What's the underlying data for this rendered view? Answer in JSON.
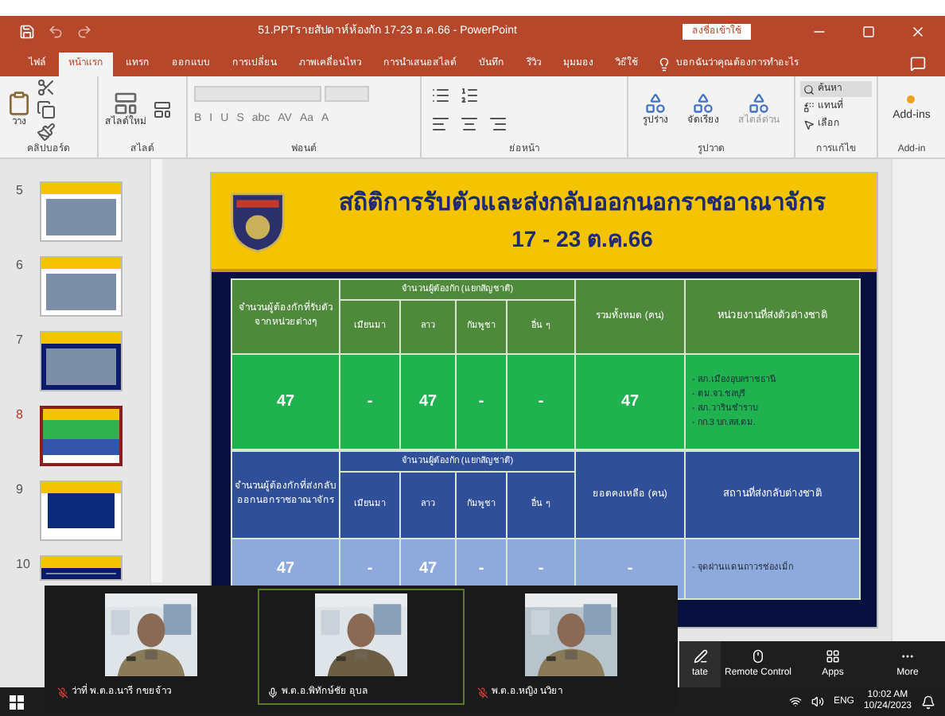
{
  "window": {
    "title": "51.PPTรายสัปดาห์ห้องกัก 17-23 ต.ค.66 - PowerPoint",
    "sign_in": "ลงชื่อเข้าใช้"
  },
  "ribbon_tabs": [
    {
      "label": "ไฟล์",
      "selected": false
    },
    {
      "label": "หน้าแรก",
      "selected": true
    },
    {
      "label": "แทรก",
      "selected": false
    },
    {
      "label": "ออกแบบ",
      "selected": false
    },
    {
      "label": "การเปลี่ยน",
      "selected": false
    },
    {
      "label": "ภาพเคลื่อนไหว",
      "selected": false
    },
    {
      "label": "การนำเสนอสไลด์",
      "selected": false
    },
    {
      "label": "บันทึก",
      "selected": false
    },
    {
      "label": "รีวิว",
      "selected": false
    },
    {
      "label": "มุมมอง",
      "selected": false
    },
    {
      "label": "วิธีใช้",
      "selected": false
    }
  ],
  "tell_me": "บอกฉันว่าคุณต้องการทำอะไร",
  "ribbon": {
    "clipboard": {
      "label": "คลิปบอร์ด",
      "paste": "วาง"
    },
    "slides": {
      "label": "สไลด์",
      "new_slide": "สไลด์ใหม่"
    },
    "font": {
      "label": "ฟอนต์",
      "buttons": [
        "B",
        "I",
        "U",
        "S",
        "abc",
        "AV",
        "Aa",
        "A"
      ]
    },
    "paragraph": {
      "label": "ย่อหน้า"
    },
    "drawing": {
      "label": "รูปวาด",
      "buttons": [
        "รูปร่าง",
        "จัดเรียง",
        "สไตล์ด่วน"
      ]
    },
    "editing": {
      "label": "การแก้ไข",
      "buttons": [
        "ค้นหา",
        "แทนที่",
        "เลือก"
      ]
    },
    "addins": {
      "label": "Add-in",
      "button": "Add-ins"
    }
  },
  "thumbnails": [
    {
      "number": "5",
      "selected": false
    },
    {
      "number": "6",
      "selected": false
    },
    {
      "number": "7",
      "selected": false
    },
    {
      "number": "8",
      "selected": true
    },
    {
      "number": "9",
      "selected": false
    },
    {
      "number": "10",
      "selected": false
    }
  ],
  "slide": {
    "title": "สถิติการรับตัวและส่งกลับออกนอกราชอาณาจักร",
    "date": "17 - 23 ต.ค.66",
    "tables": [
      {
        "first_header": "จำนวนผู้ต้องกักที่รับตัวจากหน่วยต่างๆ",
        "group_header": "จำนวนผู้ต้องกัก (แยกสัญชาติ)",
        "sub_headers": [
          "เมียนมา",
          "ลาว",
          "กัมพูชา",
          "อื่น ๆ"
        ],
        "total_header": "รวมทั้งหมด (คน)",
        "last_header": "หน่วยงานที่ส่งตัวต่างชาติ",
        "values": [
          "47",
          "-",
          "47",
          "-",
          "-",
          "47"
        ],
        "places": [
          "- สภ.เมืองอุบลราชธานี",
          "- ตม.จว.ชลบุรี",
          "- สภ.วารินชำราบ",
          "- กก.3 บก.สส.ตม."
        ]
      },
      {
        "first_header": "จำนวนผู้ต้องกักที่ส่งกลับออกนอกราชอาณาจักร",
        "group_header": "จำนวนผู้ต้องกัก (แยกสัญชาติ)",
        "sub_headers": [
          "เมียนมา",
          "ลาว",
          "กัมพูชา",
          "อื่น ๆ"
        ],
        "total_header": "ยอดคงเหลือ (คน)",
        "last_header": "สถานที่ส่งกลับต่างชาติ",
        "values": [
          "47",
          "-",
          "47",
          "-",
          "-",
          "-"
        ],
        "places": [
          "- จุดผ่านแดนถาวรช่องเม็ก"
        ]
      }
    ]
  },
  "meeting": {
    "participants": [
      {
        "name": "ว่าที่ พ.ต.อ.นารี กขยจ้าว",
        "muted": true,
        "active": false
      },
      {
        "name": "พ.ต.อ.พิทักษ์ชัย อุบล",
        "muted": false,
        "active": true
      },
      {
        "name": "พ.ต.อ.หญิง นวิยา",
        "muted": true,
        "active": false
      }
    ],
    "toolbar": [
      "tate",
      "Remote Control",
      "Apps",
      "More"
    ]
  },
  "taskbar": {
    "language": "ENG",
    "time": "10:02 AM",
    "date": "10/24/2023"
  }
}
